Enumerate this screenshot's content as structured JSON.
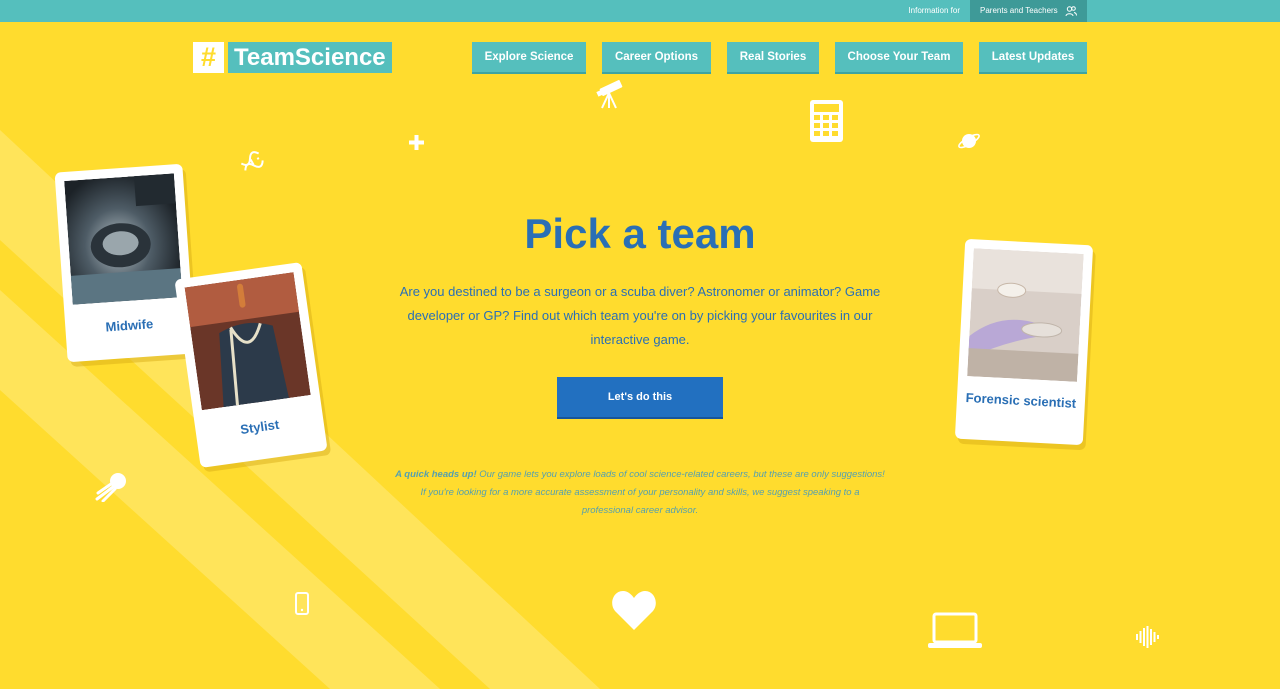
{
  "topbar": {
    "info_label": "Information for",
    "parents_teachers": "Parents and Teachers"
  },
  "logo": {
    "hash": "#",
    "word": "TeamScience"
  },
  "nav": [
    {
      "label": "Explore Science"
    },
    {
      "label": "Career Options"
    },
    {
      "label": "Real Stories"
    },
    {
      "label": "Choose Your Team"
    },
    {
      "label": "Latest Updates"
    }
  ],
  "hero": {
    "title": "Pick a team",
    "intro": "Are you destined to be a surgeon or a scuba diver? Astronomer or animator? Game developer or GP? Find out which team you're on by picking your favourites in our interactive game.",
    "cta": "Let's do this"
  },
  "notice": {
    "lead": "A quick heads up!",
    "text": " Our game lets you explore loads of cool science-related careers, but these are only suggestions! If you're looking for a more accurate assessment of your personality and skills, we suggest speaking to a professional career advisor."
  },
  "cards": [
    {
      "label": "Midwife"
    },
    {
      "label": "Stylist"
    },
    {
      "label": "Forensic scientist"
    }
  ],
  "colors": {
    "background": "#ffdc2e",
    "teal": "#55bfbd",
    "blue": "#2a6fb5",
    "button": "#2270c0"
  },
  "icons": [
    "telescope-icon",
    "calculator-icon",
    "plus-icon",
    "dna-icon",
    "planet-icon",
    "comet-icon",
    "phone-icon",
    "heart-icon",
    "laptop-icon",
    "sound-wave-icon",
    "users-icon"
  ]
}
